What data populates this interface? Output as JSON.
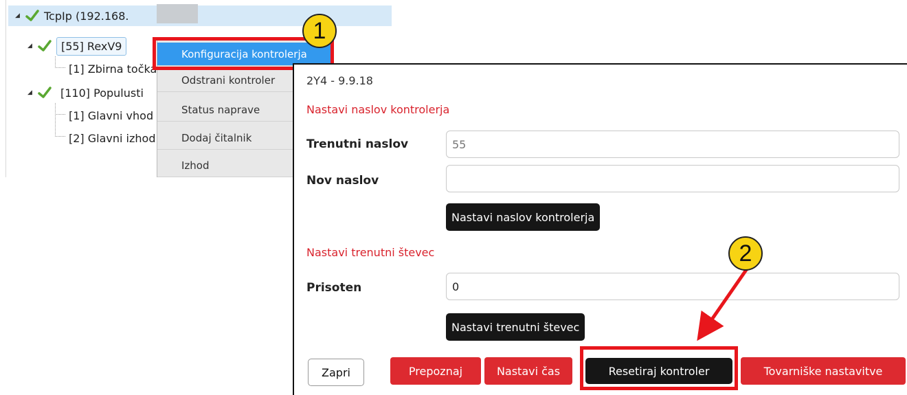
{
  "tree": {
    "root": {
      "label": "TcpIp (192.168."
    },
    "controller1": {
      "label": "[55] RexV9"
    },
    "controller1_child": {
      "label": "[1] Zbirna točka"
    },
    "controller2": {
      "label": "[110] Populusti"
    },
    "controller2_children": [
      {
        "label": "[1] Glavni vhod"
      },
      {
        "label": "[2] Glavni izhod"
      }
    ]
  },
  "context_menu": {
    "items": [
      {
        "label": "Konfiguracija kontrolerja"
      },
      {
        "label": "Odstrani kontroler"
      },
      {
        "label": "Status naprave"
      },
      {
        "label": "Dodaj čitalnik"
      },
      {
        "label": "Izhod"
      }
    ]
  },
  "dialog": {
    "title": "2Y4 - 9.9.18",
    "address_section": {
      "heading": "Nastavi naslov kontrolerja",
      "current_label": "Trenutni naslov",
      "current_value": "55",
      "new_label": "Nov naslov",
      "new_value": "",
      "button": "Nastavi naslov kontrolerja"
    },
    "counter_section": {
      "heading": "Nastavi trenutni števec",
      "present_label": "Prisoten",
      "present_value": "0",
      "button": "Nastavi trenutni števec"
    },
    "footer_buttons": {
      "close": "Zapri",
      "identify": "Prepoznaj",
      "set_time": "Nastavi čas",
      "reset": "Resetiraj kontroler",
      "factory": "Tovarniške nastavitve"
    }
  },
  "annotations": {
    "badge1": "1",
    "badge2": "2",
    "highlight_color": "#e8161c",
    "badge_color": "#f7d313"
  },
  "colors": {
    "accent_red": "#dd2a30",
    "menu_active": "#3399ee",
    "selected_row": "#d6e9f8",
    "check_green": "#5aa832"
  }
}
